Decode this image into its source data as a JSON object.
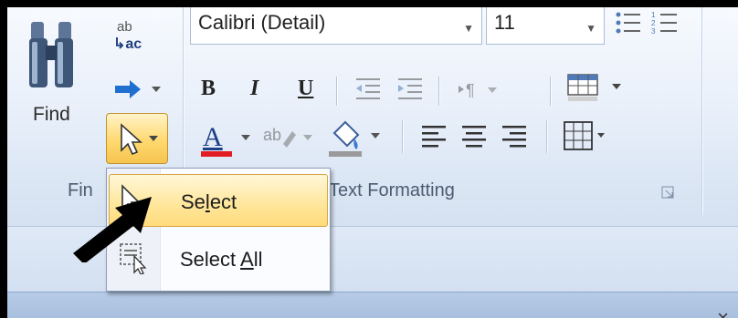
{
  "editing_group": {
    "find_label": "Find",
    "group_label_visible": "Fin"
  },
  "font_group": {
    "font_name": "Calibri (Detail)",
    "font_size": "11",
    "group_label": "Text Formatting",
    "font_color": "#e31b23",
    "highlight_color": "#9a9a9a"
  },
  "select_menu": {
    "items": [
      {
        "pre": "Se",
        "key": "l",
        "post": "ect",
        "icon": "select-cursor-icon"
      },
      {
        "pre": "Select ",
        "key": "A",
        "post": "ll",
        "icon": "select-all-icon"
      }
    ]
  },
  "window": {
    "close_glyph": "×"
  }
}
